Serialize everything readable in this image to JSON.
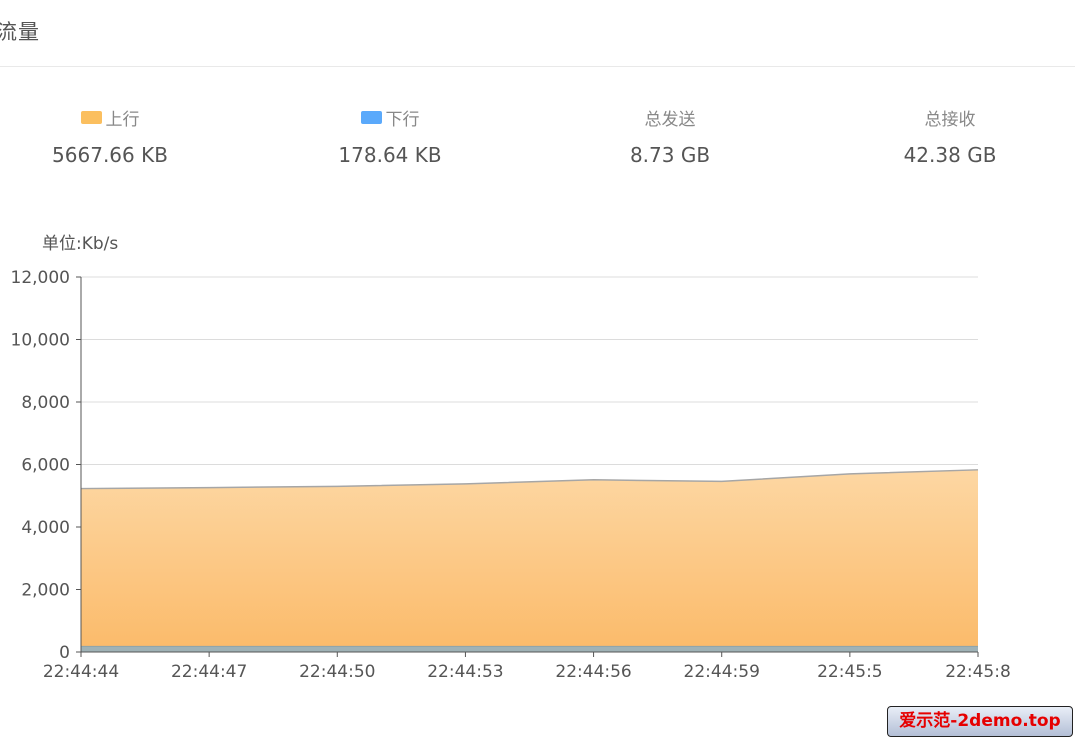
{
  "panel": {
    "title": "流量"
  },
  "stats": [
    {
      "label": "上行",
      "value": "5667.66 KB",
      "color": "#fbbf5f"
    },
    {
      "label": "下行",
      "value": "178.64 KB",
      "color": "#5aa9fb"
    },
    {
      "label": "总发送",
      "value": "8.73 GB"
    },
    {
      "label": "总接收",
      "value": "42.38 GB"
    }
  ],
  "chart_data": {
    "type": "area",
    "unit_label": "单位:Kb/s",
    "x": [
      "22:44:44",
      "22:44:47",
      "22:44:50",
      "22:44:53",
      "22:44:56",
      "22:44:59",
      "22:45:5",
      "22:45:8"
    ],
    "series": [
      {
        "name": "上行",
        "values": [
          5050,
          5080,
          5120,
          5200,
          5330,
          5280,
          5520,
          5650
        ],
        "color": "#fbbf5f",
        "stacked": true
      },
      {
        "name": "下行",
        "values": [
          180,
          180,
          180,
          180,
          180,
          180,
          180,
          180
        ],
        "color": "#5aa9fb",
        "stacked": true
      }
    ],
    "ylim": [
      0,
      12000
    ],
    "yticks": [
      "0",
      "2,000",
      "4,000",
      "6,000",
      "8,000",
      "10,000",
      "12,000"
    ],
    "grid": true
  },
  "watermark": "爱示范-2demo.top"
}
